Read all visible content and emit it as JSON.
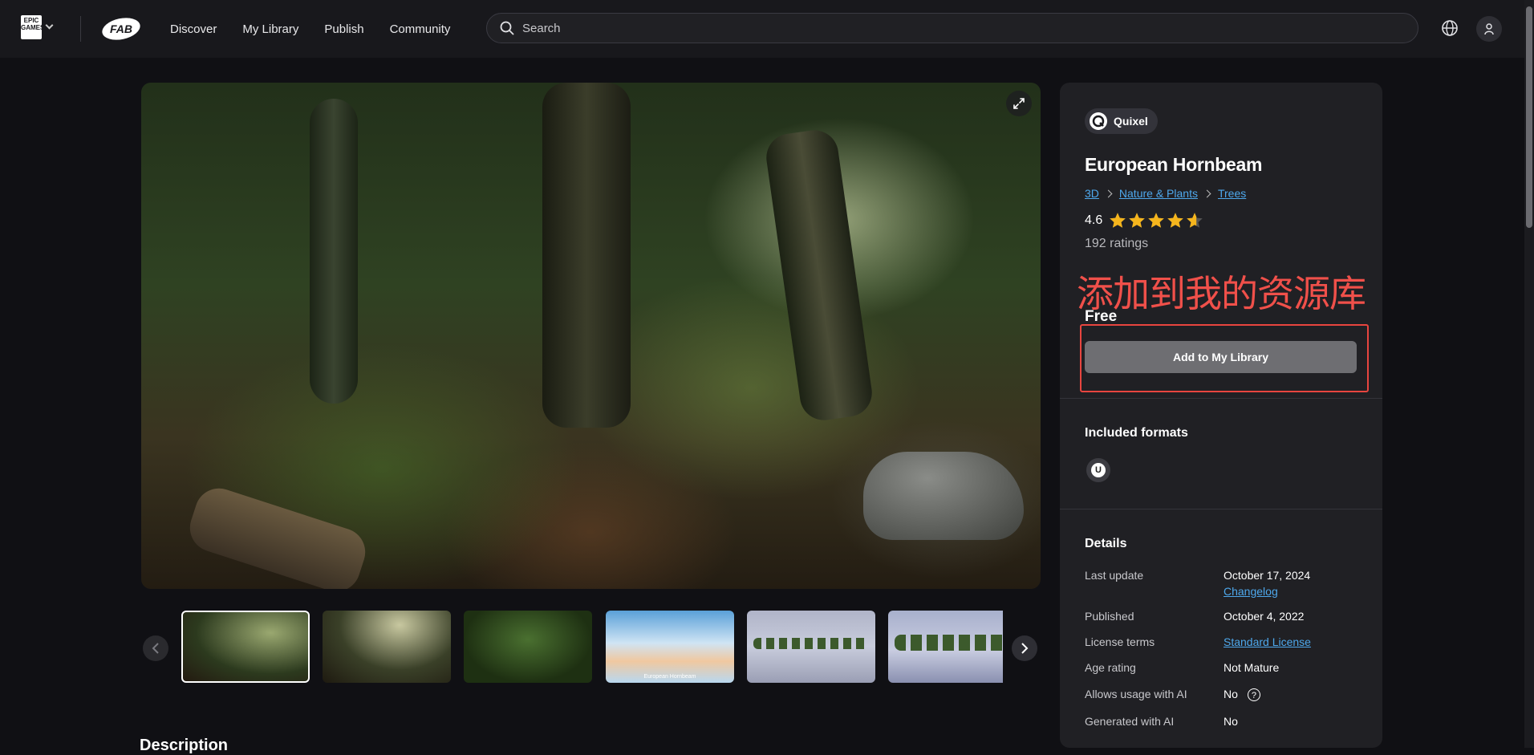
{
  "header": {
    "epic_logo_text": "EPIC GAMES",
    "fab_logo_text": "FAB",
    "nav": [
      "Discover",
      "My Library",
      "Publish",
      "Community"
    ],
    "search_placeholder": "Search"
  },
  "product": {
    "seller": "Quixel",
    "title": "European Hornbeam",
    "breadcrumbs": [
      "3D",
      "Nature & Plants",
      "Trees"
    ],
    "rating": "4.6",
    "rating_value": 4.6,
    "ratings_count": "192 ratings",
    "price": "Free",
    "add_button": "Add to My Library",
    "annotation": "添加到我的资源库"
  },
  "formats": {
    "title": "Included formats",
    "items": [
      "unreal-engine-icon"
    ]
  },
  "details": {
    "title": "Details",
    "rows": [
      {
        "label": "Last update",
        "value": "October 17, 2024",
        "link": "Changelog"
      },
      {
        "label": "Published",
        "value": "October 4, 2022"
      },
      {
        "label": "License terms",
        "value": "Standard License"
      },
      {
        "label": "Age rating",
        "value": "Not Mature"
      },
      {
        "label": "Allows usage with AI",
        "value": "No"
      },
      {
        "label": "Generated with AI",
        "value": "No"
      }
    ]
  },
  "gallery": {
    "thumb_count": 6,
    "active_index": 0,
    "thumb_caption": "European Hornbeam"
  },
  "description_heading": "Description",
  "colors": {
    "background": "#101014",
    "topbar": "#18181c",
    "panel": "#202024",
    "link": "#4ea8ec",
    "star": "#f5b51d",
    "annotation": "#e8453f",
    "button": "#6e6e72"
  }
}
